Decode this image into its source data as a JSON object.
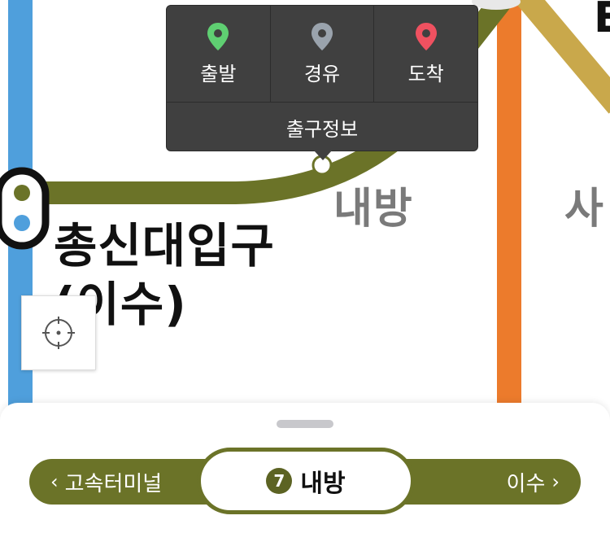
{
  "popup": {
    "departure_label": "출발",
    "via_label": "경유",
    "arrival_label": "도착",
    "exit_info_label": "출구정보",
    "colors": {
      "departure": "#5fcf72",
      "via": "#9aa3ad",
      "arrival": "#ef5160"
    }
  },
  "map": {
    "station_current": "내방",
    "station_transfer_line1": "총신대입구",
    "station_transfer_line2": "(이수)",
    "station_right_partial": "사",
    "station_top_partial": "E",
    "colors": {
      "line7": "#6b7328",
      "line4": "#4f9fdc",
      "orange": "#ec7b2c",
      "gold": "#c9a84b"
    }
  },
  "bottom_sheet": {
    "prev_station": "고속터미널",
    "next_station": "이수",
    "current_station": "내방",
    "line_number": "7"
  }
}
